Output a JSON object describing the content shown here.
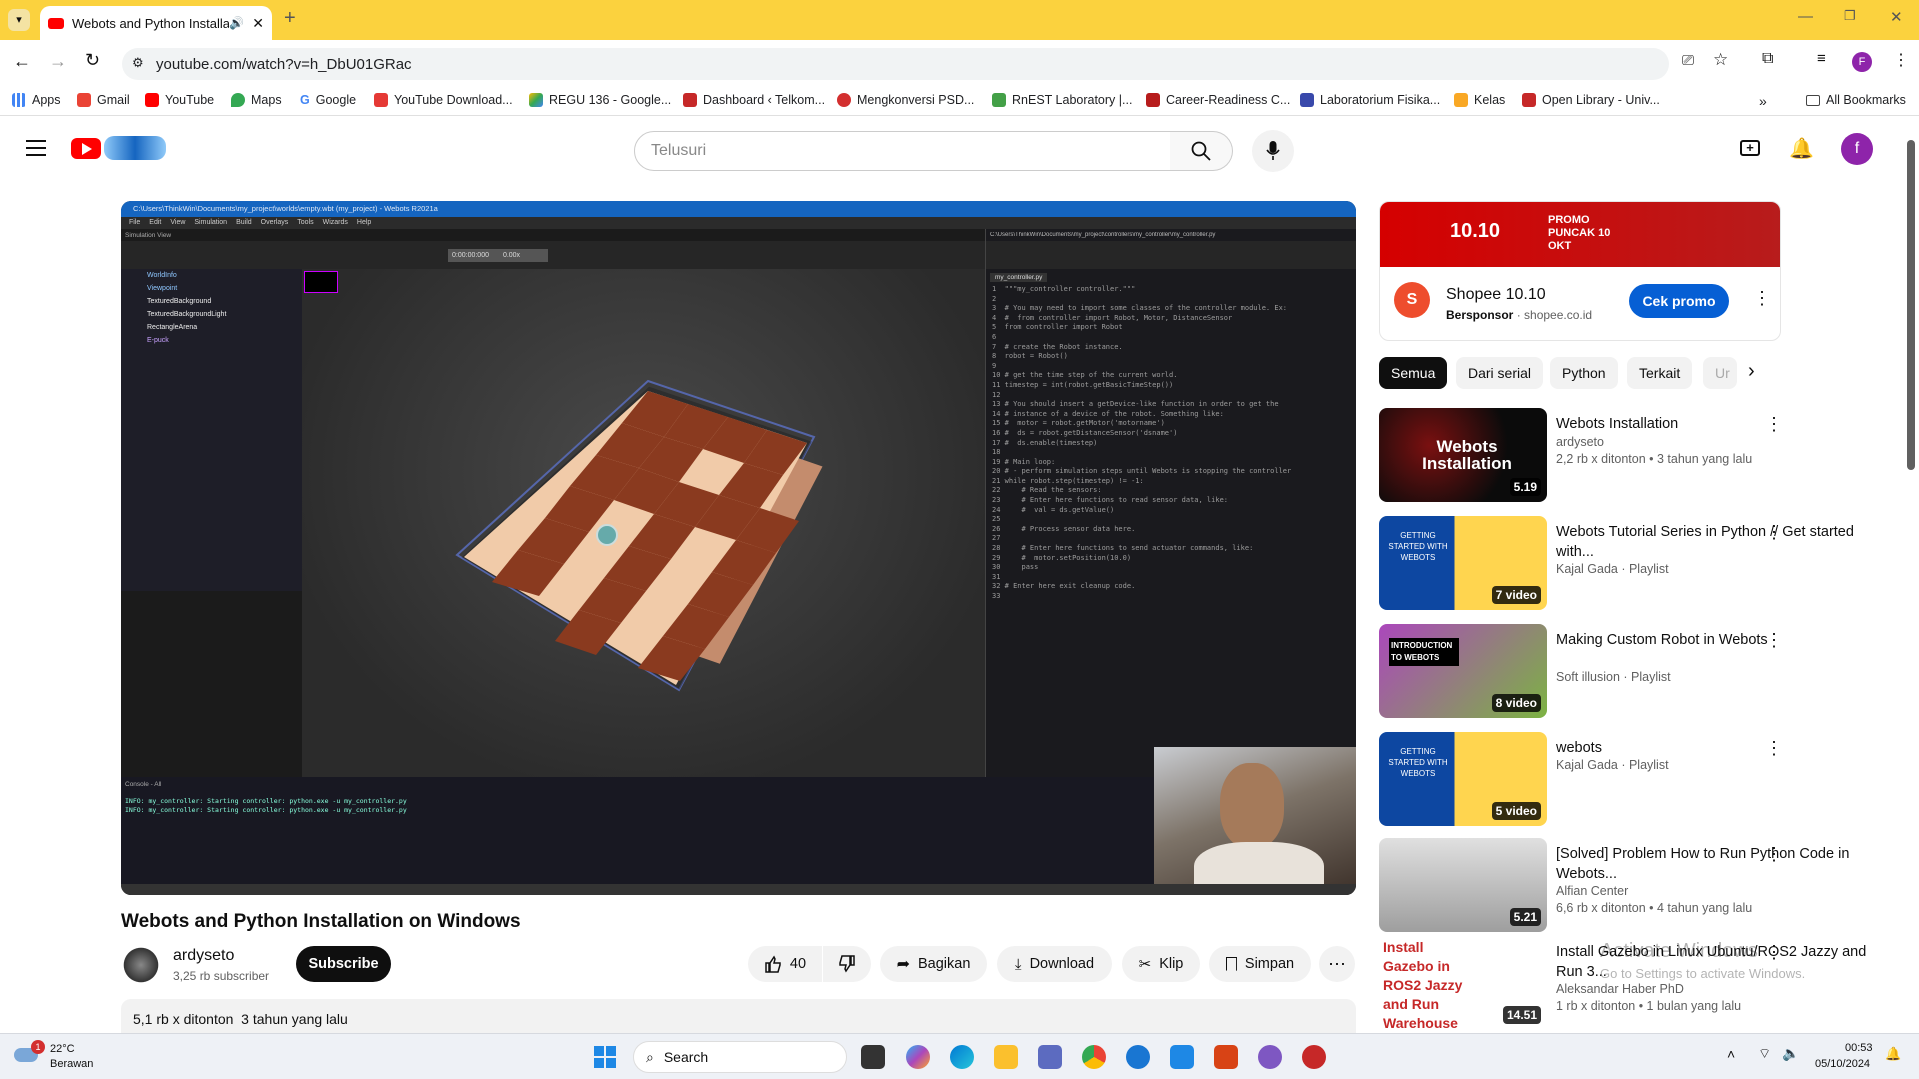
{
  "browser": {
    "tab_title": "Webots and Python Installa",
    "url": "youtube.com/watch?v=h_DbU01GRac",
    "bookmarks": [
      "Apps",
      "Gmail",
      "YouTube",
      "Maps",
      "Google",
      "YouTube Download...",
      "REGU 136 - Google...",
      "Dashboard ‹ Telkom...",
      "Mengkonversi PSD...",
      "RnEST Laboratory |...",
      "Career-Readiness C...",
      "Laboratorium Fisika...",
      "Kelas",
      "Open Library - Univ..."
    ],
    "all_bookmarks": "All Bookmarks",
    "profile_initial": "F"
  },
  "header": {
    "search_placeholder": "Telusuri",
    "avatar_initial": "f"
  },
  "video": {
    "title": "Webots and Python Installation on Windows",
    "channel": "ardyseto",
    "subscribers": "3,25 rb subscriber",
    "subscribe_label": "Subscribe",
    "likes": "40",
    "share_label": "Bagikan",
    "download_label": "Download",
    "clip_label": "Klip",
    "save_label": "Simpan",
    "views_date": "5,1 rb x ditonton  3 tahun yang lalu"
  },
  "webots": {
    "window_title": "C:\\Users\\ThinkWin\\Documents\\my_project\\worlds\\empty.wbt (my_project) - Webots R2021a",
    "menu": [
      "File",
      "Edit",
      "View",
      "Simulation",
      "Build",
      "Overlays",
      "Tools",
      "Wizards",
      "Help"
    ],
    "scene_tree": [
      "WorldInfo",
      "Viewpoint",
      "TexturedBackground",
      "TexturedBackgroundLight",
      "RectangleArena",
      "E-puck"
    ],
    "sim_view_label": "Simulation View",
    "time": "0:00:00:000",
    "speed": "0.00x",
    "editor_path": "C:\\Users\\ThinkWin\\Documents\\my_project\\controllers\\my_controller\\my_controller.py",
    "editor_tab": "my_controller.py",
    "console_title": "Console - All",
    "console_lines": [
      "INFO: my_controller: Starting controller: python.exe -u my_controller.py",
      "INFO: my_controller: Starting controller: python.exe -u my_controller.py"
    ],
    "code": "1  \"\"\"my_controller controller.\"\"\"\n2\n3  # You may need to import some classes of the controller module. Ex:\n4  #  from controller import Robot, Motor, DistanceSensor\n5  from controller import Robot\n6\n7  # create the Robot instance.\n8  robot = Robot()\n9\n10 # get the time step of the current world.\n11 timestep = int(robot.getBasicTimeStep())\n12\n13 # You should insert a getDevice-like function in order to get the\n14 # instance of a device of the robot. Something like:\n15 #  motor = robot.getMotor('motorname')\n16 #  ds = robot.getDistanceSensor('dsname')\n17 #  ds.enable(timestep)\n18\n19 # Main loop:\n20 # - perform simulation steps until Webots is stopping the controller\n21 while robot.step(timestep) != -1:\n22     # Read the sensors:\n23     # Enter here functions to read sensor data, like:\n24     #  val = ds.getValue()\n25\n26     # Process sensor data here.\n27\n28     # Enter here functions to send actuator commands, like:\n29     #  motor.setPosition(10.0)\n30     pass\n31\n32 # Enter here exit cleanup code.\n33"
  },
  "ad": {
    "banner_brand": "10.10",
    "banner_text": "PROMO PUNCAK 10 OKT",
    "title": "Shopee 10.10",
    "sponsor": "Bersponsor",
    "domain": "shopee.co.id",
    "cta": "Cek promo"
  },
  "chips": [
    "Semua",
    "Dari serial",
    "Python",
    "Terkait",
    "Ur"
  ],
  "recommendations": [
    {
      "title": "Webots Installation",
      "channel": "ardyseto",
      "meta": "2,2 rb x ditonton • 3 tahun yang lalu",
      "badge": "5.19",
      "thumb_text": "Webots Installation"
    },
    {
      "title": "Webots Tutorial Series in Python // Get started with...",
      "channel": "Kajal Gada · Playlist",
      "meta": "",
      "badge": "7 video",
      "thumb_text": "GETTING STARTED WITH WEBOTS"
    },
    {
      "title": "Making Custom Robot in Webots",
      "channel": "Soft illusion · Playlist",
      "meta": "",
      "badge": "8 video",
      "thumb_text": "INTRODUCTION TO WEBOTS"
    },
    {
      "title": "webots",
      "channel": "Kajal Gada · Playlist",
      "meta": "",
      "badge": "5 video",
      "thumb_text": "GETTING STARTED WITH WEBOTS"
    },
    {
      "title": "[Solved] Problem How to Run Python Code in Webots...",
      "channel": "Alfian Center",
      "meta": "6,6 rb x ditonton • 4 tahun yang lalu",
      "badge": "5.21",
      "thumb_text": ""
    },
    {
      "title": "Install Gazebo in Linux Ubuntu/ROS2 Jazzy and Run 3...",
      "channel": "Aleksandar Haber PhD",
      "meta": "1 rb x ditonton • 1 bulan yang lalu",
      "badge": "14.51",
      "thumb_text": "Install Gazebo in ROS2 Jazzy and Run Warehouse Robot"
    }
  ],
  "watermark": {
    "line1": "Activate Windows",
    "line2": "Go to Settings to activate Windows."
  },
  "taskbar": {
    "temp": "22°C",
    "weather": "Berawan",
    "weather_badge": "1",
    "search": "Search",
    "time": "00:53",
    "date": "05/10/2024"
  },
  "colors": {
    "youtube_red": "#ff0000",
    "chrome_yellow": "#fbd23e",
    "cta_blue": "#065fd4"
  }
}
